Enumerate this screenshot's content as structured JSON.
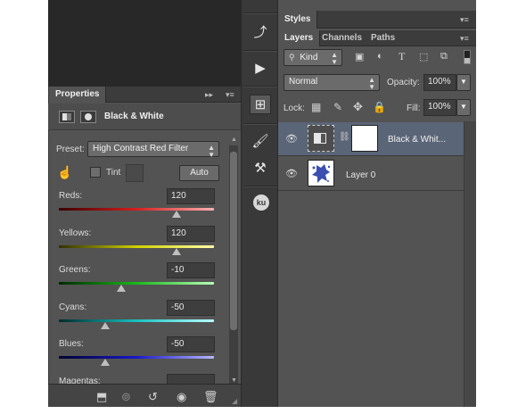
{
  "properties": {
    "tab_label": "Properties",
    "adjustment_title": "Black & White",
    "preset_label": "Preset:",
    "preset_value": "High Contrast Red Filter",
    "tint_label": "Tint",
    "auto_label": "Auto",
    "sliders": [
      {
        "label": "Reds:",
        "value": "120",
        "level": 0.76,
        "gradient": "linear-gradient(90deg,#3b0000,#d41e1e,#ffb0b0)"
      },
      {
        "label": "Yellows:",
        "value": "120",
        "level": 0.76,
        "gradient": "linear-gradient(90deg,#2f2f00,#d0d000,#ffffa8)"
      },
      {
        "label": "Greens:",
        "value": "-10",
        "level": 0.4,
        "gradient": "linear-gradient(90deg,#002a00,#18b818,#b8ffb8)"
      },
      {
        "label": "Cyans:",
        "value": "-50",
        "level": 0.3,
        "gradient": "linear-gradient(90deg,#002b2b,#18c0c0,#b8ffff)"
      },
      {
        "label": "Blues:",
        "value": "-50",
        "level": 0.3,
        "gradient": "linear-gradient(90deg,#00002e,#1818c8,#b8b8ff)"
      },
      {
        "label": "Magentas:",
        "value": "",
        "level": 0.5,
        "gradient": "linear-gradient(90deg,#2b002b,#c818c8,#ffb8ff)"
      }
    ]
  },
  "styles": {
    "tab_label": "Styles"
  },
  "layers": {
    "tabs": [
      "Layers",
      "Channels",
      "Paths"
    ],
    "filter_kind": "Kind",
    "blend_mode": "Normal",
    "opacity_label": "Opacity:",
    "opacity_value": "100%",
    "lock_label": "Lock:",
    "fill_label": "Fill:",
    "fill_value": "100%",
    "rows": [
      {
        "name": "Black & Whit..."
      },
      {
        "name": "Layer 0"
      }
    ]
  },
  "toolbar": {
    "ku_label": "ku"
  },
  "colors": {
    "panel_bg": "#535353",
    "header_bg": "#3c3c3c",
    "selected_row": "#5a6577"
  }
}
